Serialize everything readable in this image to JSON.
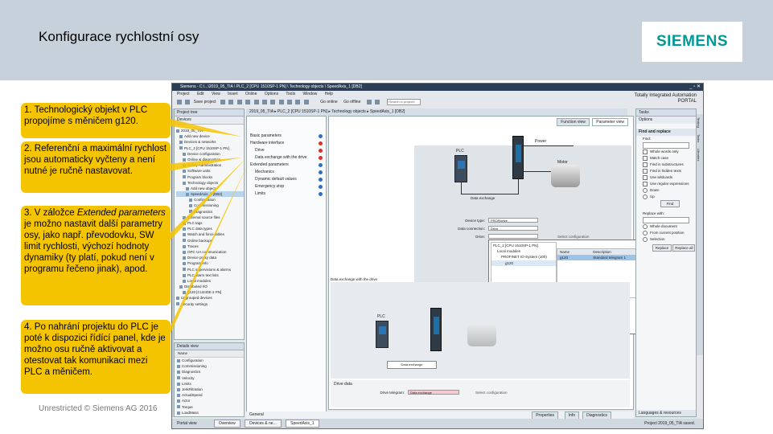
{
  "slide": {
    "title": "Konfigurace rychlostní osy",
    "logo_text": "SIEMENS",
    "footer": "Unrestricted © Siemens AG 2016",
    "colors": {
      "header_band": "#c6d1dc",
      "callout": "#f4c400",
      "logo": "#009999"
    }
  },
  "callouts": [
    {
      "text": "1. Technologický objekt v PLC propojíme s měničem g120."
    },
    {
      "text": "2. Referenční a maximální rychlost jsou automaticky vyčteny a není nutné je ručně nastavovat."
    },
    {
      "text_before": "3. V záložce ",
      "text_italic": "Extended parameters",
      "text_after": " je možno nastavit další parametry osy, jako např. převodovku, SW limit rychlosti, výchozí hodnoty dynamiky (ty platí, pokud není v programu řečeno jinak), apod."
    },
    {
      "text": "4. Po nahrání projektu do PLC je poté k dispozici řídící panel, kde je možno osu ručně aktivovat a otestovat tak komunikaci mezi PLC a měničem."
    }
  ],
  "tia": {
    "title": "Siemens - C:\\...\\2019_05_TIA \\ PLC_2 [CPU 1510SP-1 PN] \\ Technology objects \\ SpeedAxis_1 [DB2]",
    "menu": [
      "Project",
      "Edit",
      "View",
      "Insert",
      "Online",
      "Options",
      "Tools",
      "Window",
      "Help"
    ],
    "toolbar_save": "Save project",
    "toolbar_online": "Go online",
    "toolbar_offline": "Go offline",
    "search_placeholder": "<Search in project>",
    "brand_line1": "Totally Integrated Automation",
    "brand_line2": "PORTAL",
    "breadcrumb": "2019_05_TIA ▸ PLC_2 [CPU 1510SP-1 PN] ▸ Technology objects ▸ SpeedAxis_1 [DB2]",
    "project_tree": {
      "header": "Project tree",
      "tab": "Devices",
      "items": [
        {
          "label": "2019_05_TIA"
        },
        {
          "label": "Add new device"
        },
        {
          "label": "Devices & networks"
        },
        {
          "label": "PLC_2 [CPU 1510SP-1 PN]"
        },
        {
          "label": "Device configuration"
        },
        {
          "label": "Online & diagnostics"
        },
        {
          "label": "Safety Administration"
        },
        {
          "label": "Software units"
        },
        {
          "label": "Program blocks"
        },
        {
          "label": "Technology objects"
        },
        {
          "label": "Add new object"
        },
        {
          "label": "SpeedAxis_1 [DB2]",
          "selected": true
        },
        {
          "label": "Configuration"
        },
        {
          "label": "Commissioning"
        },
        {
          "label": "Diagnostics"
        },
        {
          "label": "External source files"
        },
        {
          "label": "PLC tags"
        },
        {
          "label": "PLC data types"
        },
        {
          "label": "Watch and force tables"
        },
        {
          "label": "Online backups"
        },
        {
          "label": "Traces"
        },
        {
          "label": "OPC UA communication"
        },
        {
          "label": "Device proxy data"
        },
        {
          "label": "Program info"
        },
        {
          "label": "PLC supervisions & alarms"
        },
        {
          "label": "PLC alarm text lists"
        },
        {
          "label": "Local modules"
        },
        {
          "label": "Distributed I/O"
        },
        {
          "label": "g120 [CU240E-2 PN]"
        },
        {
          "label": "Ungrouped devices"
        },
        {
          "label": "Security settings"
        }
      ]
    },
    "details_view": {
      "header": "Details view",
      "column": "Name",
      "items": [
        "Configuration",
        "Commissioning",
        "Diagnostics",
        "Velocity",
        "Limits",
        "JerkFiltration",
        "ActualSpeed",
        "Actor",
        "Torque",
        "LoadMass"
      ]
    },
    "function_nav": {
      "items": [
        {
          "label": "Basic parameters",
          "status": "ok"
        },
        {
          "label": "Hardware interface",
          "status": "err"
        },
        {
          "label": "Drive",
          "status": "err"
        },
        {
          "label": "Data exchange with the drive",
          "status": "err"
        },
        {
          "label": "Extended parameters",
          "status": "ok"
        },
        {
          "label": "Mechanics",
          "status": "ok"
        },
        {
          "label": "Dynamic default values",
          "status": "ok"
        },
        {
          "label": "Emergency stop",
          "status": "ok"
        },
        {
          "label": "Limits",
          "status": "ok"
        }
      ],
      "status_colors": {
        "ok": "#2f6fc0",
        "err": "#d9322b"
      }
    },
    "editor": {
      "tab_function_view": "Function view",
      "tab_parameter_view": "Parameter view",
      "label_power": "Power",
      "label_plc": "PLC",
      "label_motor": "Motor",
      "label_data_exchange": "Data exchange",
      "device_type_label": "Device type:",
      "device_type_value": "PROFIdrive",
      "data_conn_label": "Data connection:",
      "data_conn_value": "Drive",
      "drive_label": "Drive:",
      "drive_popup": {
        "tree": [
          "PLC_2 [CPU 1510SP-1 PN]",
          "Local modules",
          "PROFINET IO-System (100)",
          "g120"
        ],
        "show_all_label": "Show all modules",
        "col_name": "Name",
        "col_description": "Description",
        "row_name": "g120",
        "row_description": "Standard telegram 1"
      },
      "section_label": "Data exchange with the drive",
      "plc_label_2": "PLC",
      "drive_data_label": "Drive data",
      "drive_telegram_label": "Drive telegram:",
      "drive_telegram_value": "Data exchange",
      "select_config_label": "Select configuration"
    },
    "inspector": {
      "tab_general": "General",
      "tab_properties": "Properties",
      "tab_info": "Info",
      "tab_diagnostics": "Diagnostics"
    },
    "tasks": {
      "header": "Tasks",
      "options_label": "Options",
      "find_replace_label": "Find and replace",
      "find_label": "Find:",
      "checkboxes": [
        "Whole words only",
        "Match case",
        "Find in substructures",
        "Find in hidden texts",
        "Use wildcards",
        "Use regular expressions"
      ],
      "down_label": "Down",
      "up_label": "Up",
      "find_button": "Find",
      "replace_with_label": "Replace with:",
      "radios": [
        "Whole document",
        "From current position",
        "Selection"
      ],
      "replace_button": "Replace",
      "replace_all_button": "Replace all",
      "languages_label": "Languages & resources",
      "vtabs": [
        "Testing",
        "Tasks",
        "Libraries"
      ]
    },
    "bottombar": {
      "portal_view": "Portal view",
      "tab_overview": "Overview",
      "tab_devices": "Devices & ne...",
      "tab_speedaxis": "SpeedAxis_1",
      "status_text": "Project 2019_05_TIA saved."
    }
  }
}
